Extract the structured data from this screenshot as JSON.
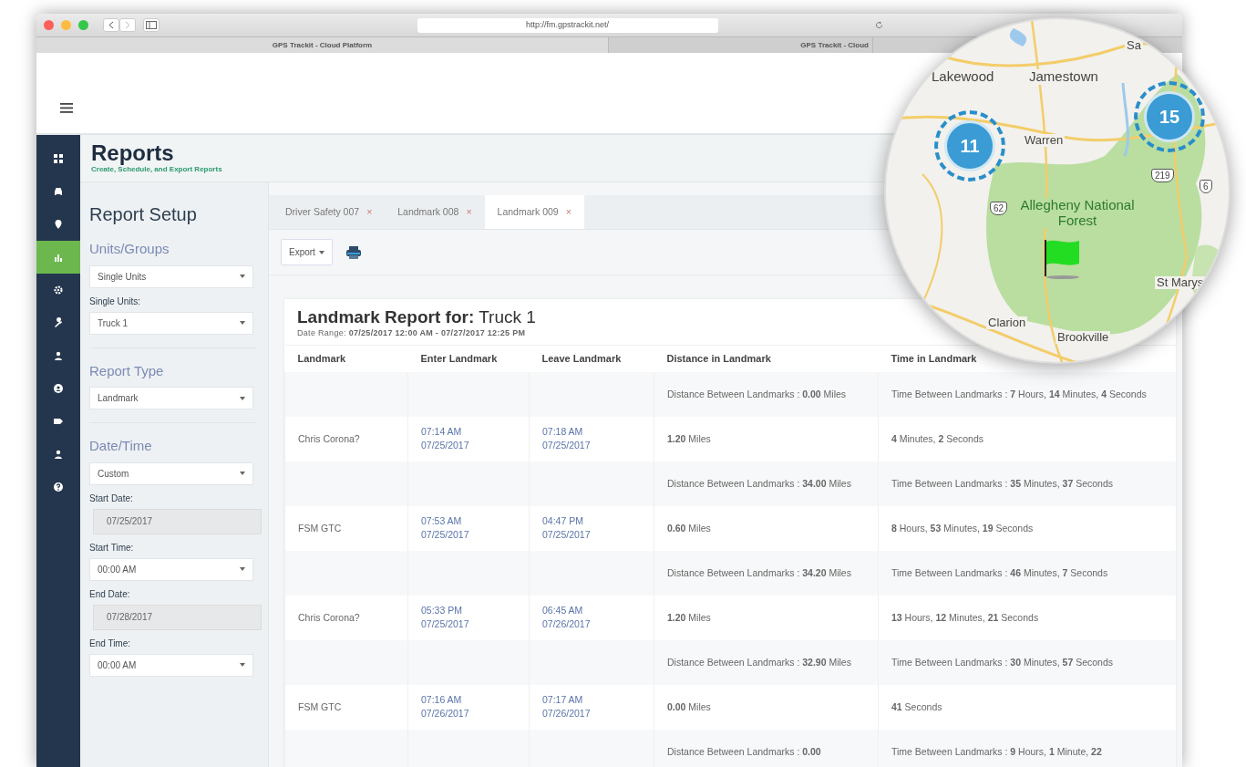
{
  "browser": {
    "url": "http://fm.gpstrackit.net/",
    "tabs": [
      {
        "label": "GPS Trackit - Cloud Platform",
        "selected": true
      },
      {
        "label": "GPS Trackit - Cloud",
        "selected": false
      }
    ]
  },
  "nav": [
    {
      "selected": false
    },
    {
      "selected": false
    },
    {
      "selected": false
    },
    {
      "selected": true
    },
    {
      "selected": false
    },
    {
      "selected": false
    },
    {
      "selected": false
    },
    {
      "selected": false
    },
    {
      "selected": false
    },
    {
      "selected": false
    },
    {
      "selected": false
    }
  ],
  "page": {
    "title": "Reports",
    "subtitle": "Create, Schedule, and Export Reports"
  },
  "setup": {
    "title": "Report Setup",
    "sections": [
      {
        "title": "Units/Groups",
        "fields": [
          {
            "kind": "select",
            "value": "Single Units"
          },
          {
            "kind": "select",
            "label": "Single Units:",
            "value": "Truck 1"
          }
        ]
      },
      {
        "title": "Report Type",
        "fields": [
          {
            "kind": "select",
            "value": "Landmark"
          }
        ]
      },
      {
        "title": "Date/Time",
        "fields": [
          {
            "kind": "select",
            "value": "Custom"
          },
          {
            "kind": "date",
            "label": "Start Date:",
            "value": "07/25/2017"
          },
          {
            "kind": "select",
            "label": "Start Time:",
            "value": "00:00 AM"
          },
          {
            "kind": "date",
            "label": "End Date:",
            "value": "07/28/2017"
          },
          {
            "kind": "select",
            "label": "End Time:",
            "value": "00:00 AM"
          }
        ]
      }
    ]
  },
  "report_tabs": [
    {
      "label": "Driver Safety 007",
      "close": "×",
      "selected": false
    },
    {
      "label": "Landmark 008",
      "close": "×",
      "selected": false
    },
    {
      "label": "Landmark 009",
      "close": "×",
      "selected": true
    }
  ],
  "toolbar": {
    "export": "Export"
  },
  "report": {
    "title": "**Landmark Report for:** Truck 1",
    "date_range": "Date Range: **07/25/2017 12:00 AM - 07/27/2017 12:25 PM**"
  },
  "table": {
    "columns": [
      "Landmark",
      "Enter Landmark",
      "Leave Landmark",
      "Distance in Landmark",
      "Time in Landmark"
    ],
    "rows": [
      {
        "kind": "between",
        "distance": "Distance Between Landmarks : **0.00** Miles",
        "time": "Time Between Landmarks : **7** Hours, **14** Minutes, **4** Seconds"
      },
      {
        "kind": "visit",
        "landmark": "Chris Corona?",
        "enter": {
          "time": "07:14 AM",
          "date": "07/25/2017"
        },
        "leave": {
          "time": "07:18 AM",
          "date": "07/25/2017"
        },
        "distance": "**1.20** Miles",
        "time": "**4** Minutes, **2** Seconds"
      },
      {
        "kind": "between",
        "distance": "Distance Between Landmarks : **34.00** Miles",
        "time": "Time Between Landmarks : **35** Minutes, **37** Seconds"
      },
      {
        "kind": "visit",
        "landmark": "FSM GTC",
        "enter": {
          "time": "07:53 AM",
          "date": "07/25/2017"
        },
        "leave": {
          "time": "04:47 PM",
          "date": "07/25/2017"
        },
        "distance": "**0.60** Miles",
        "time": "**8** Hours, **53** Minutes, **19** Seconds"
      },
      {
        "kind": "between",
        "distance": "Distance Between Landmarks : **34.20** Miles",
        "time": "Time Between Landmarks : **46** Minutes, **7** Seconds"
      },
      {
        "kind": "visit",
        "landmark": "Chris Corona?",
        "enter": {
          "time": "05:33 PM",
          "date": "07/25/2017"
        },
        "leave": {
          "time": "06:45 AM",
          "date": "07/26/2017"
        },
        "distance": "**1.20** Miles",
        "time": "**13** Hours, **12** Minutes, **21** Seconds"
      },
      {
        "kind": "between",
        "distance": "Distance Between Landmarks : **32.90** Miles",
        "time": "Time Between Landmarks : **30** Minutes, **57** Seconds"
      },
      {
        "kind": "visit",
        "landmark": "FSM GTC",
        "enter": {
          "time": "07:16 AM",
          "date": "07/26/2017"
        },
        "leave": {
          "time": "07:17 AM",
          "date": "07/26/2017"
        },
        "distance": "**0.00** Miles",
        "time": "**41** Seconds"
      },
      {
        "kind": "between",
        "distance": "Distance Between Landmarks : **0.00**",
        "time": "Time Between Landmarks : **9** Hours, **1** Minute, **22**"
      }
    ]
  },
  "map": {
    "places": [
      "Sa",
      "Lakewood",
      "Jamestown",
      "Warren",
      "Allegheny National Forest",
      "St Marys",
      "Clarion",
      "Brookville"
    ],
    "shields": [
      "62",
      "219",
      "6"
    ],
    "clusters": [
      {
        "count": "11"
      },
      {
        "count": "15"
      }
    ]
  }
}
